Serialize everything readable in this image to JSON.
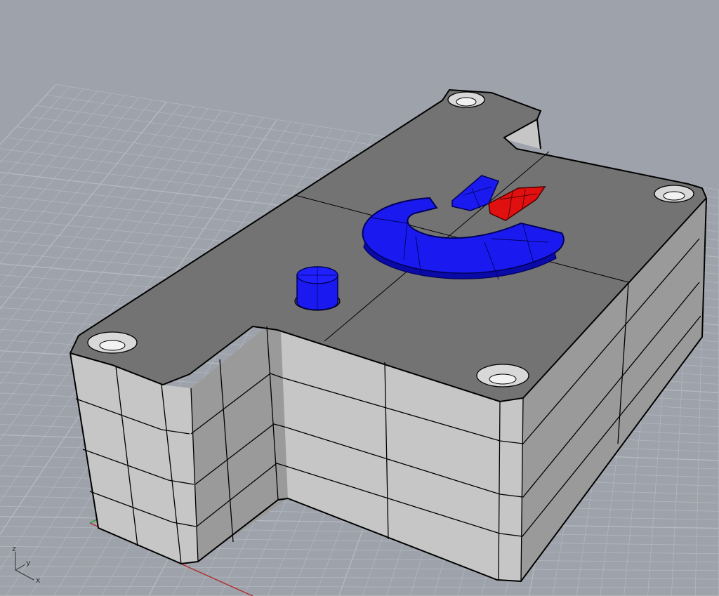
{
  "viewport": {
    "view_type": "perspective",
    "background_color": "#9ea3ab",
    "grid_color": "#b4b9c0",
    "grid_visible": true
  },
  "model": {
    "body_top_color": "#737373",
    "body_side_color": "#c6c6c6",
    "body_side_dark_color": "#9a9a9a",
    "edge_color": "#000000",
    "selected_color": "#1a1af0",
    "highlight_color": "#e01010"
  },
  "axes_gizmo": {
    "z_label": "z",
    "y_label": "y",
    "x_label": "x"
  }
}
